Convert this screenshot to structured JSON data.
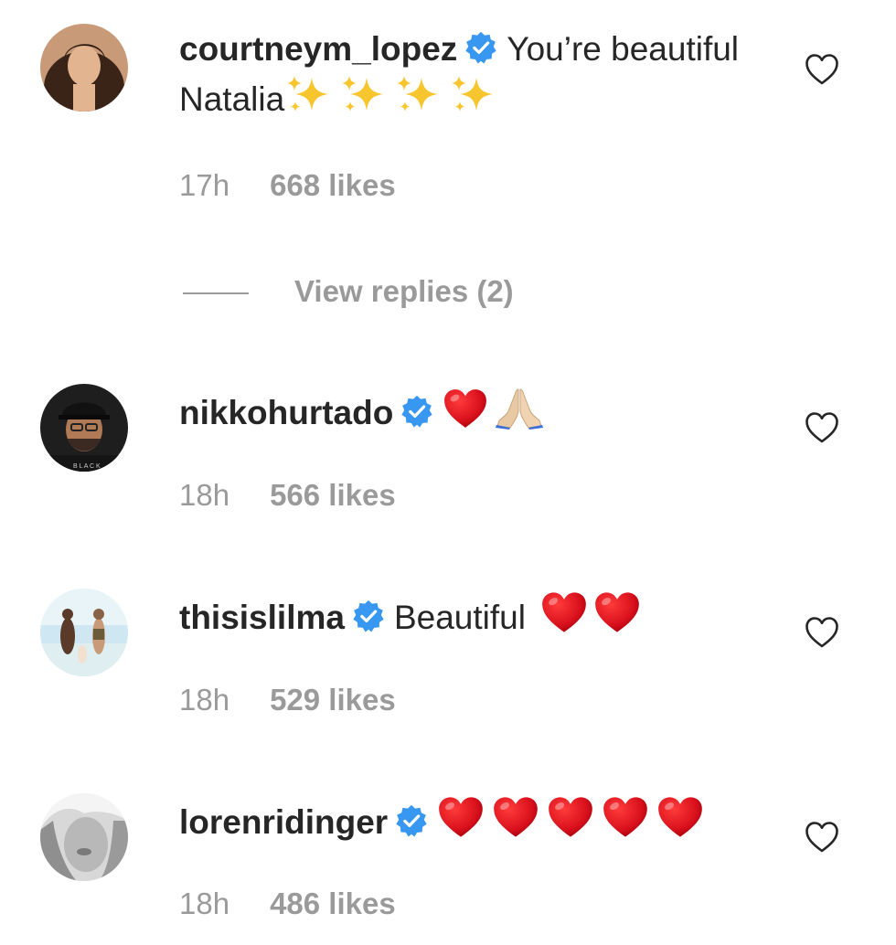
{
  "comments": [
    {
      "username": "courtneym_lopez",
      "text": "You’re beautiful Natalia",
      "emoji": "sparkles x4",
      "time": "17h",
      "likes": "668 likes"
    },
    {
      "username": "nikkohurtado",
      "text": "",
      "emoji": "red-heart, folded-hands",
      "time": "18h",
      "likes": "566 likes"
    },
    {
      "username": "thisislilma",
      "text": "Beautiful",
      "emoji": "red-heart x2",
      "time": "18h",
      "likes": "529 likes"
    },
    {
      "username": "lorenridinger",
      "text": "",
      "emoji": "red-heart x5",
      "time": "18h",
      "likes": "486 likes"
    }
  ],
  "view_replies_label": "View replies (2)",
  "colors": {
    "verified_blue": "#3897f0",
    "meta_gray": "#9a9a9a",
    "text_dark": "#262626",
    "heart_red": "#e0152a"
  }
}
